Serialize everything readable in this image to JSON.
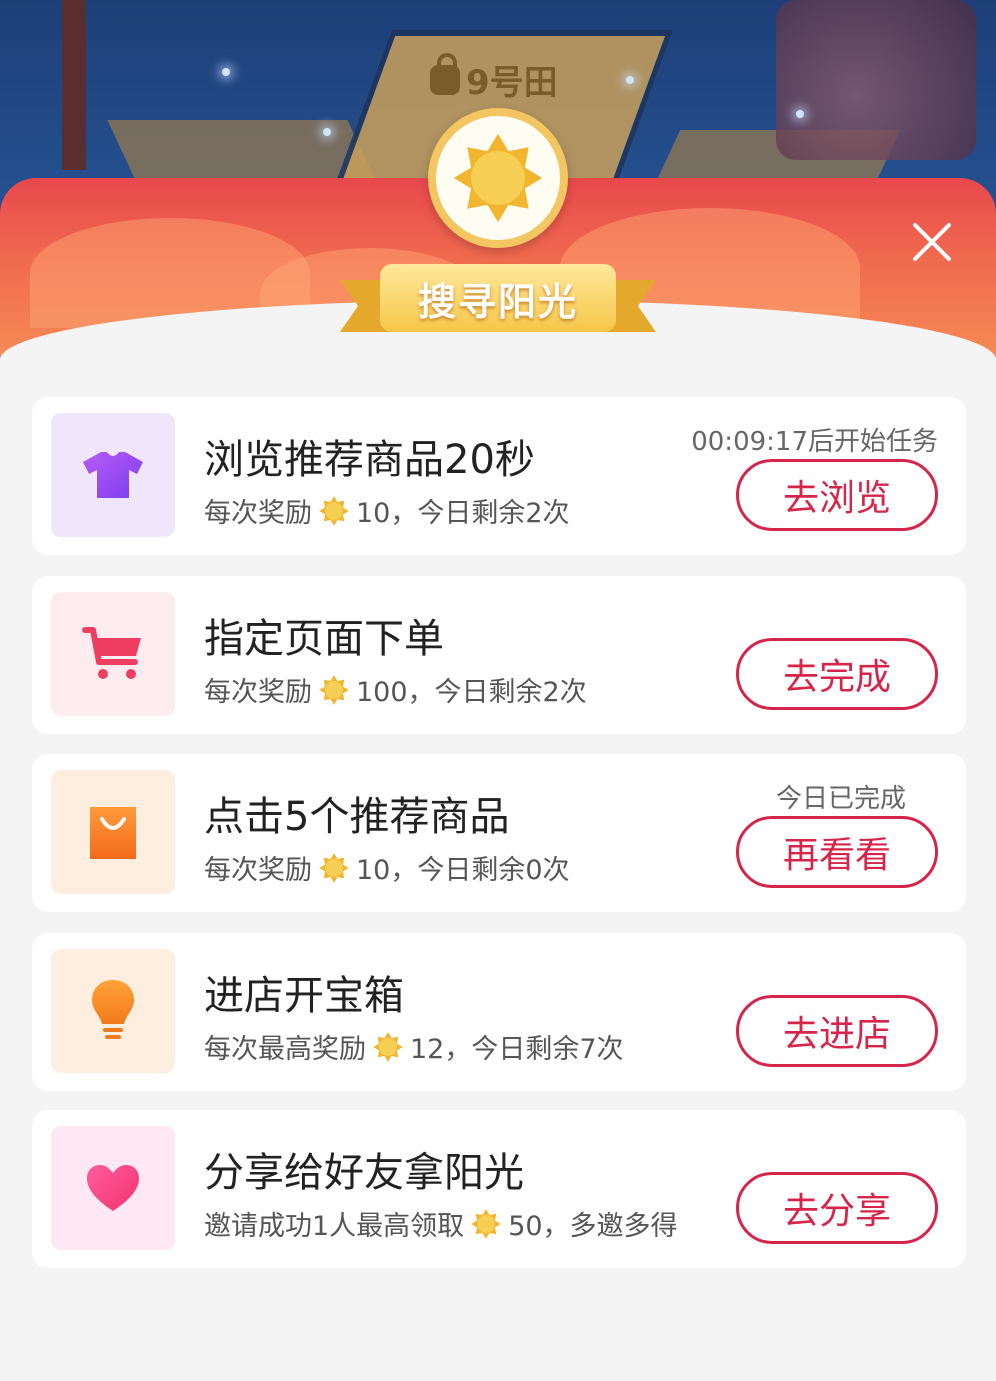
{
  "background": {
    "plot_label": "9号田"
  },
  "header": {
    "title": "搜寻阳光"
  },
  "colors": {
    "accent": "#d6254a",
    "banner": "#f06a4e",
    "gold": "#f6c64a"
  },
  "tasks": [
    {
      "icon": "shirt-icon",
      "title": "浏览推荐商品20秒",
      "reward_prefix": "每次奖励",
      "reward_suffix": "10，今日剩余2次",
      "status": "00:09:17后开始任务",
      "button": "去浏览"
    },
    {
      "icon": "cart-icon",
      "title": "指定页面下单",
      "reward_prefix": "每次奖励",
      "reward_suffix": "100，今日剩余2次",
      "status": "",
      "button": "去完成"
    },
    {
      "icon": "bag-icon",
      "title": "点击5个推荐商品",
      "reward_prefix": "每次奖励",
      "reward_suffix": "10，今日剩余0次",
      "status": "今日已完成",
      "button": "再看看"
    },
    {
      "icon": "lightbulb-icon",
      "title": "进店开宝箱",
      "reward_prefix": "每次最高奖励",
      "reward_suffix": "12，今日剩余7次",
      "status": "",
      "button": "去进店"
    },
    {
      "icon": "heart-icon",
      "title": "分享给好友拿阳光",
      "reward_prefix": "邀请成功1人最高领取",
      "reward_suffix": "50，多邀多得",
      "status": "",
      "button": "去分享"
    }
  ]
}
